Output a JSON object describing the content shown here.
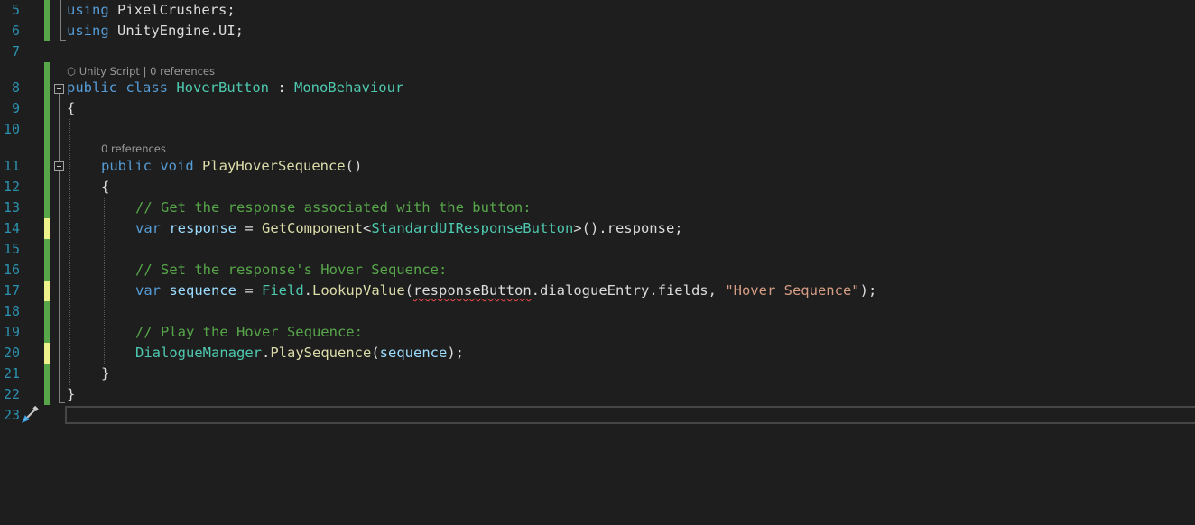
{
  "line_numbers": [
    "5",
    "6",
    "7",
    "8",
    "9",
    "10",
    "11",
    "12",
    "13",
    "14",
    "15",
    "16",
    "17",
    "18",
    "19",
    "20",
    "21",
    "22",
    "23"
  ],
  "codelens": {
    "class_lens_kind": "Unity Script",
    "class_lens_sep": "|",
    "class_lens_refs": "0 references",
    "method_lens_refs": "0 references"
  },
  "code": {
    "l5_kw": "using",
    "l5_ns": " PixelCrushers;",
    "l6_kw": "using",
    "l6_ns": " UnityEngine.UI;",
    "l8_kw1": "public",
    "l8_kw2": " class",
    "l8_name": " HoverButton",
    "l8_colon": " : ",
    "l8_base": "MonoBehaviour",
    "l9": "{",
    "l11_kw1": "public",
    "l11_kw2": " void",
    "l11_fn": " PlayHoverSequence",
    "l11_paren": "()",
    "l12": "{",
    "l13": "// Get the response associated with the button:",
    "l14_kw": "var",
    "l14_var": " response",
    "l14_eq": " = ",
    "l14_fn": "GetComponent",
    "l14_lt": "<",
    "l14_ty": "StandardUIResponseButton",
    "l14_rest": ">().response;",
    "l16": "// Set the response's Hover Sequence:",
    "l17_kw": "var",
    "l17_var": " sequence",
    "l17_eq": " = ",
    "l17_ty": "Field",
    "l17_dot": ".",
    "l17_fn": "LookupValue",
    "l17_open": "(",
    "l17_err": "responseButton",
    "l17_mid": ".dialogueEntry.fields, ",
    "l17_str": "\"Hover Sequence\"",
    "l17_end": ");",
    "l19": "// Play the Hover Sequence:",
    "l20_ty": "DialogueManager",
    "l20_dot": ".",
    "l20_fn": "PlaySequence",
    "l20_open": "(",
    "l20_var": "sequence",
    "l20_end": ");",
    "l21": "}",
    "l22": "}"
  }
}
